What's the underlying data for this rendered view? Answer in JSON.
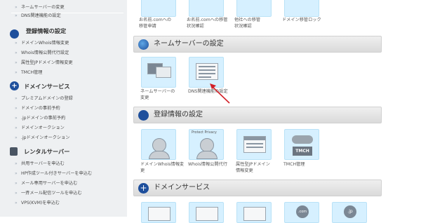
{
  "sidebar": {
    "top_items": [
      "ネームサーバーの変更",
      "DNS関連機能の設定"
    ],
    "sections": [
      {
        "title": "登録情報の設定",
        "icon": "user-cycle-icon",
        "items": [
          "ドメインWhois情報変更",
          "Whois情報公開代行設定",
          "属性型JPドメイン情報変更",
          "TMCH管理"
        ]
      },
      {
        "title": "ドメインサービス",
        "icon": "plus-circle-icon",
        "items": [
          "プレミアムドメインの登録",
          "ドメインの事前予約",
          ".jpドメインの事前予約",
          "ドメインオークション",
          ".jpドメインオークション"
        ]
      },
      {
        "title": "レンタルサーバー",
        "icon": "server-icon",
        "items": [
          "共用サーバーを申込む",
          "HP作成ツール付きサーバーを申込む",
          "メール専用サーバーを申込む",
          "一斉メール配信ツールを申込む",
          "VPS(KVM)を申込む"
        ]
      }
    ]
  },
  "main": {
    "top_tiles": [
      {
        "caption": "お名前.comへの\n移管申請",
        "icon": "transfer-request-icon"
      },
      {
        "caption": "お名前.comへの移管\n状況確認",
        "icon": "transfer-status-icon"
      },
      {
        "caption": "他社への移管\n状況確認",
        "icon": "transfer-out-status-icon"
      },
      {
        "caption": "ドメイン移管ロック",
        "icon": "transfer-lock-icon"
      }
    ],
    "sections": [
      {
        "title": "ネームサーバーの設定",
        "icon": "globe-icon",
        "tiles": [
          {
            "caption": "ネームサーバーの\n変更",
            "icon": "nameserver-change-icon"
          },
          {
            "caption": "DNS関連機能の設定",
            "icon": "dns-settings-icon"
          }
        ]
      },
      {
        "title": "登録情報の設定",
        "icon": "user-cycle-icon",
        "tiles": [
          {
            "caption": "ドメインWhois情報変\n更",
            "icon": "whois-change-icon"
          },
          {
            "caption": "Whois情報公開代行",
            "icon": "whois-privacy-icon",
            "label": "Protect Privacy"
          },
          {
            "caption": "属性型JPドメイン\n情報変更",
            "icon": "jp-attribute-icon"
          },
          {
            "caption": "TMCH管理",
            "icon": "tmch-key-icon",
            "label": "TMCH"
          }
        ]
      },
      {
        "title": "ドメインサービス",
        "icon": "plus-circle-icon",
        "tiles": [
          {
            "caption": "",
            "icon": "premium-domain-icon"
          },
          {
            "caption": "",
            "icon": "domain-preorder-icon"
          },
          {
            "caption": "",
            "icon": "jp-preorder-icon"
          },
          {
            "caption": "",
            "icon": "domain-auction-icon",
            "label": ".com"
          },
          {
            "caption": "",
            "icon": "jp-auction-icon",
            "label": ".jp"
          }
        ]
      }
    ]
  },
  "colors": {
    "sidebar_bg": "#eef0f2",
    "tile_bg": "#d6f0ff",
    "header_bg": "#e3e3e3",
    "icon_blue": "#1e4f9c",
    "arrow_red": "#d21f27"
  }
}
